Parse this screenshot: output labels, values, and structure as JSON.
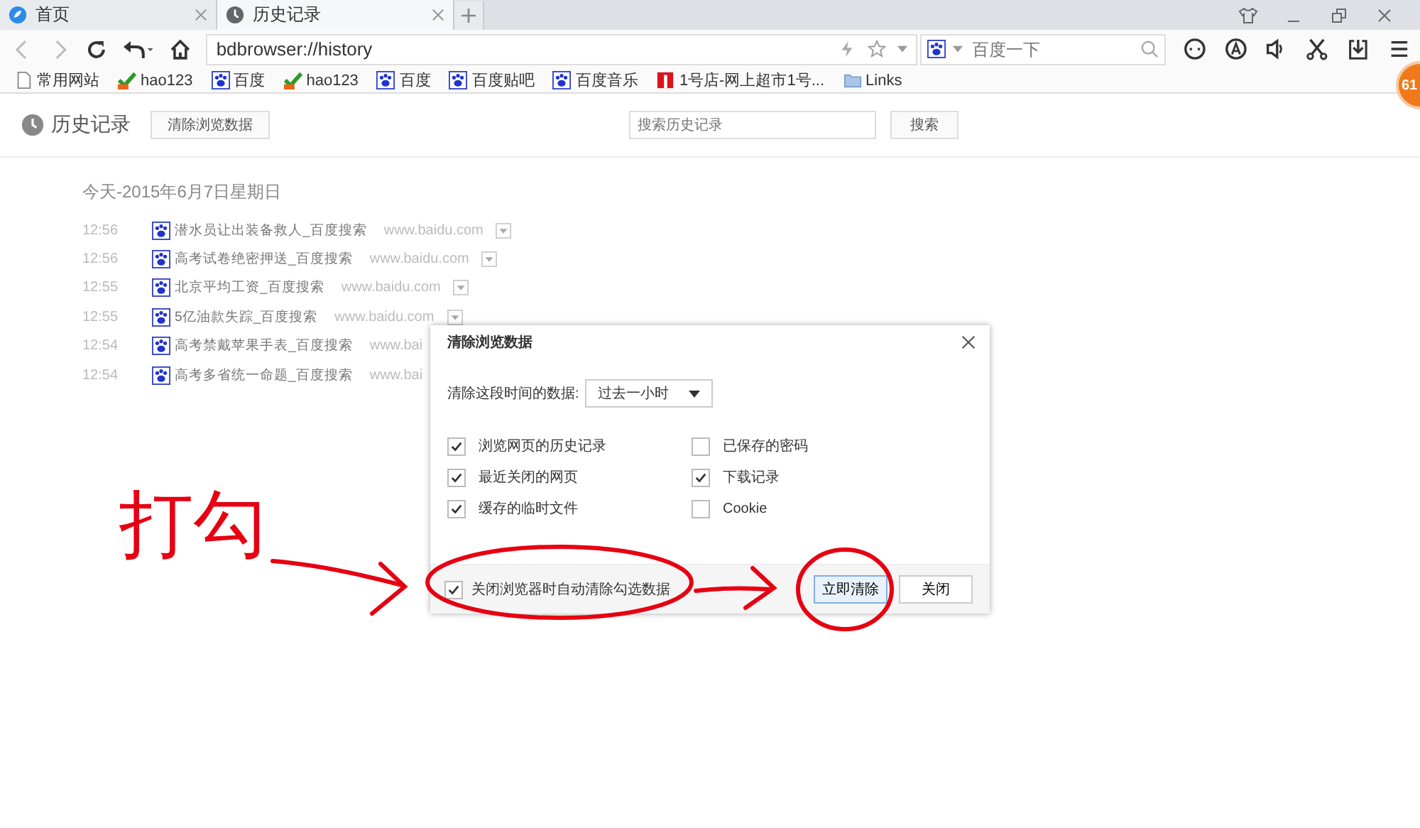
{
  "tabs": [
    {
      "label": "首页",
      "selected": false
    },
    {
      "label": "历史记录",
      "selected": true
    }
  ],
  "address": {
    "value": "bdbrowser://history"
  },
  "search": {
    "placeholder": "百度一下"
  },
  "bookmarks": [
    {
      "label": "常用网站",
      "kind": "page"
    },
    {
      "label": "hao123",
      "kind": "check"
    },
    {
      "label": "百度",
      "kind": "paw"
    },
    {
      "label": "hao123",
      "kind": "check"
    },
    {
      "label": "百度",
      "kind": "paw"
    },
    {
      "label": "百度贴吧",
      "kind": "paw"
    },
    {
      "label": "百度音乐",
      "kind": "paw"
    },
    {
      "label": "1号店-网上超市1号...",
      "kind": "flag"
    },
    {
      "label": "Links",
      "kind": "folder"
    }
  ],
  "badge": "61",
  "page": {
    "title": "历史记录",
    "clear_button": "清除浏览数据",
    "search_placeholder": "搜索历史记录",
    "search_button": "搜索",
    "date": "今天-2015年6月7日星期日"
  },
  "history": [
    {
      "time": "12:56",
      "title": "潜水员让出装备救人_百度搜索",
      "url": "www.baidu.com",
      "menu": true
    },
    {
      "time": "12:56",
      "title": "高考试卷绝密押送_百度搜索",
      "url": "www.baidu.com",
      "menu": true
    },
    {
      "time": "12:55",
      "title": "北京平均工资_百度搜索",
      "url": "www.baidu.com",
      "menu": true
    },
    {
      "time": "12:55",
      "title": "5亿油款失踪_百度搜索",
      "url": "www.baidu.com",
      "menu": true
    },
    {
      "time": "12:54",
      "title": "高考禁戴苹果手表_百度搜索",
      "url": "www.bai",
      "menu": false
    },
    {
      "time": "12:54",
      "title": "高考多省统一命题_百度搜索",
      "url": "www.bai",
      "menu": false
    }
  ],
  "dialog": {
    "title": "清除浏览数据",
    "range_label": "清除这段时间的数据:",
    "range_value": "过去一小时",
    "options": [
      {
        "label": "浏览网页的历史记录",
        "checked": true
      },
      {
        "label": "已保存的密码",
        "checked": false
      },
      {
        "label": "最近关闭的网页",
        "checked": true
      },
      {
        "label": "下载记录",
        "checked": true
      },
      {
        "label": "缓存的临时文件",
        "checked": true
      },
      {
        "label": "Cookie",
        "checked": false
      }
    ],
    "auto_clear": {
      "label": "关闭浏览器时自动清除勾选数据",
      "checked": true
    },
    "buttons": [
      {
        "label": "立即清除",
        "primary": true
      },
      {
        "label": "关闭",
        "primary": false
      }
    ]
  },
  "annotation": {
    "note": "打勾"
  }
}
